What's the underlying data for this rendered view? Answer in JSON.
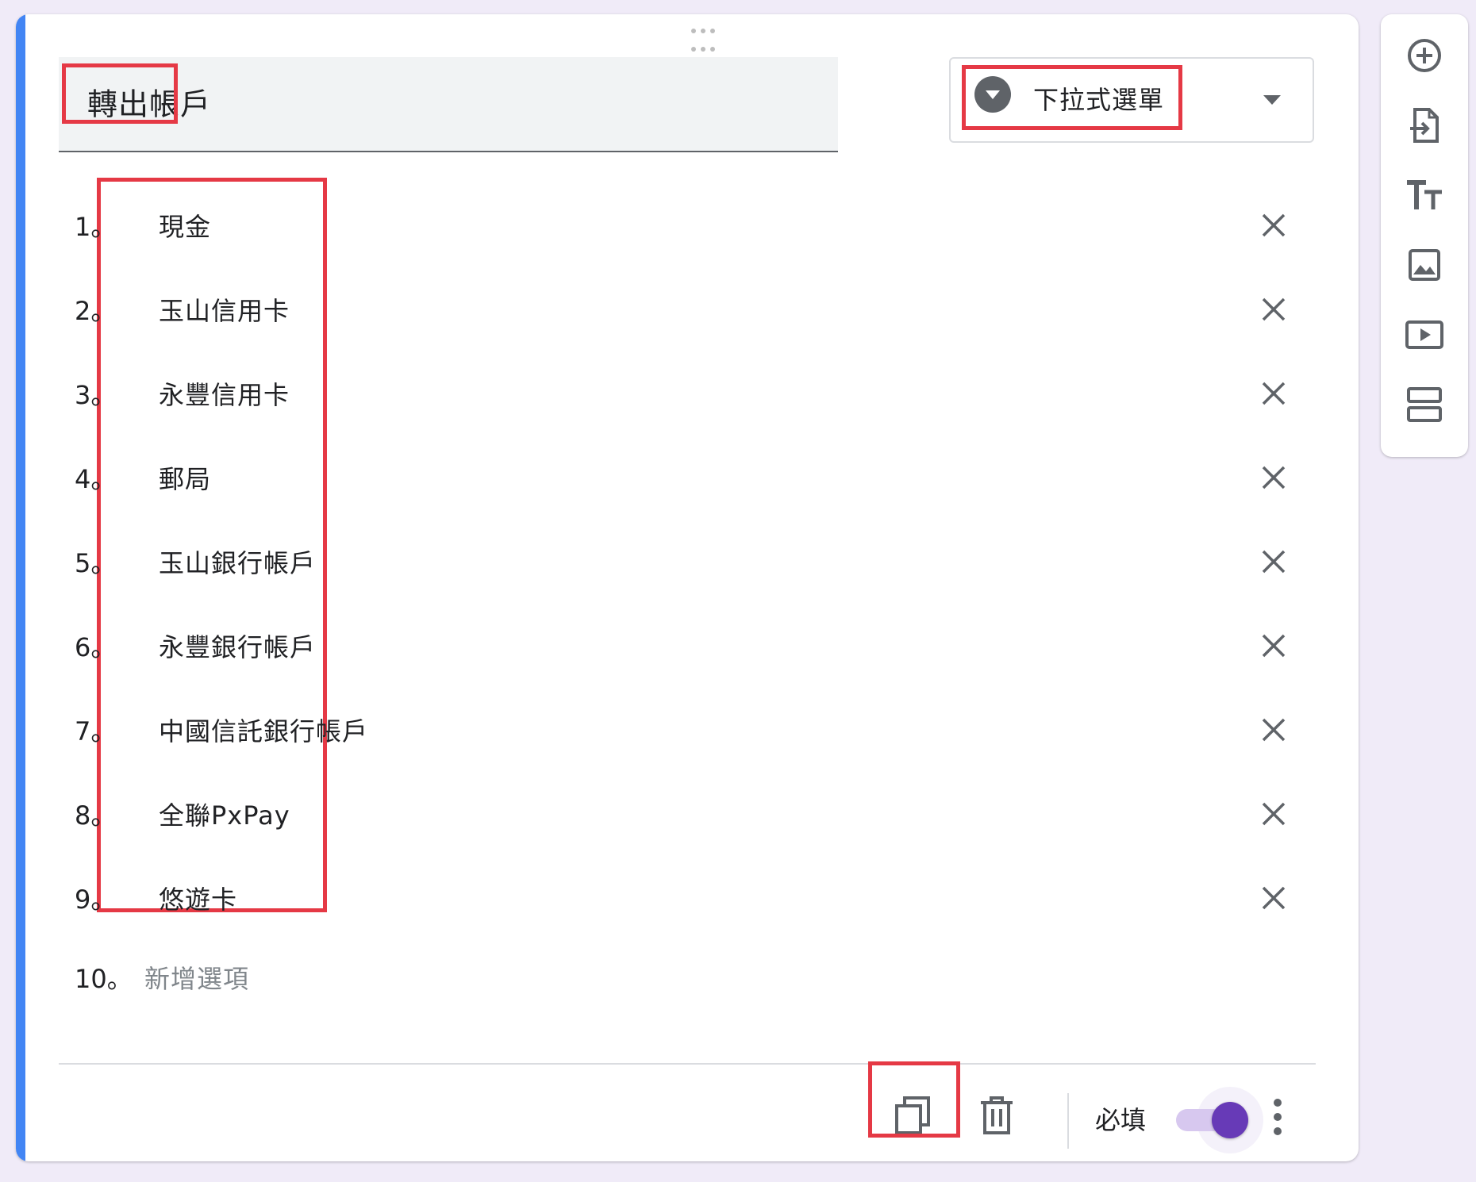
{
  "question": {
    "title": "轉出帳戶",
    "type_label": "下拉式選單"
  },
  "options": [
    {
      "num": "1。",
      "label": "現金"
    },
    {
      "num": "2。",
      "label": "玉山信用卡"
    },
    {
      "num": "3。",
      "label": "永豐信用卡"
    },
    {
      "num": "4。",
      "label": "郵局"
    },
    {
      "num": "5。",
      "label": "玉山銀行帳戶"
    },
    {
      "num": "6。",
      "label": "永豐銀行帳戶"
    },
    {
      "num": "7。",
      "label": "中國信託銀行帳戶"
    },
    {
      "num": "8。",
      "label": "全聯PxPay"
    },
    {
      "num": "9。",
      "label": "悠遊卡"
    }
  ],
  "add_option": {
    "num": "10。",
    "placeholder": "新增選項"
  },
  "footer": {
    "required_label": "必填",
    "required_on": true,
    "copy_icon": "copy-icon",
    "delete_icon": "trash-icon",
    "more_icon": "more-vert-icon"
  },
  "sidebar_icons": [
    "add-question-icon",
    "import-question-icon",
    "title-text-icon",
    "image-icon",
    "video-icon",
    "section-icon"
  ],
  "colors": {
    "accent": "#4285f4",
    "toggle": "#673ab7",
    "highlight": "#e53945",
    "background": "#f0ebf8"
  }
}
